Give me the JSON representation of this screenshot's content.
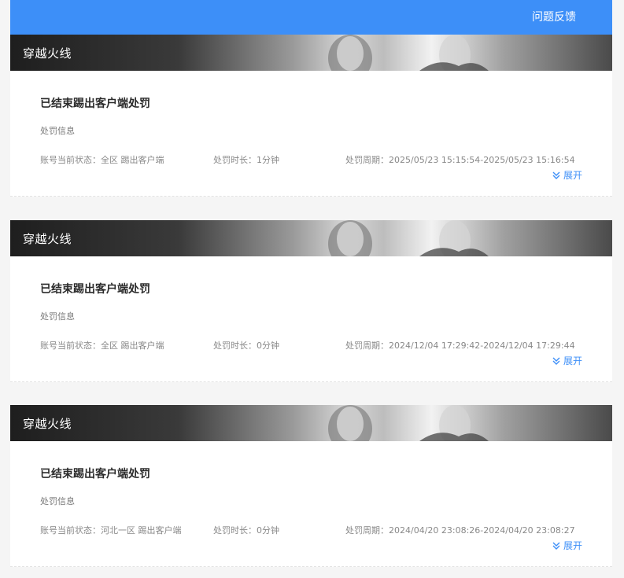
{
  "header": {
    "feedback_label": "问题反馈"
  },
  "labels": {
    "section": "处罚信息",
    "account_status": "账号当前状态：",
    "duration": "处罚时长：",
    "period": "处罚周期：",
    "expand": "展开"
  },
  "records": [
    {
      "game": "穿越火线",
      "title": "已结束踢出客户端处罚",
      "account_status": "全区 踢出客户端",
      "duration": "1分钟",
      "period": "2025/05/23 15:15:54-2025/05/23 15:16:54"
    },
    {
      "game": "穿越火线",
      "title": "已结束踢出客户端处罚",
      "account_status": "全区 踢出客户端",
      "duration": "0分钟",
      "period": "2024/12/04 17:29:42-2024/12/04 17:29:44"
    },
    {
      "game": "穿越火线",
      "title": "已结束踢出客户端处罚",
      "account_status": "河北一区 踢出客户端",
      "duration": "0分钟",
      "period": "2024/04/20 23:08:26-2024/04/20 23:08:27"
    }
  ],
  "icons": {
    "expand": "double-chevron-down-icon"
  },
  "colors": {
    "accent": "#3d8ff8"
  }
}
